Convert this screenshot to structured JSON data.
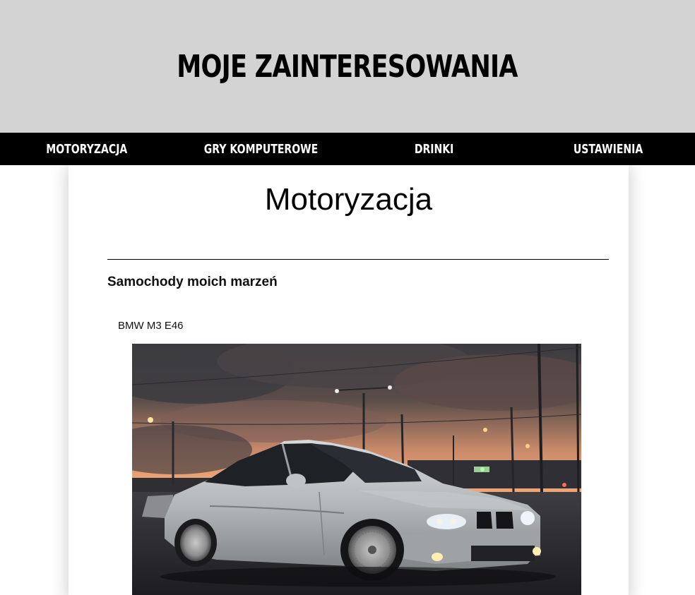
{
  "header": {
    "title": "MOJE ZAINTERESOWANIA"
  },
  "nav": {
    "items": [
      {
        "label": "MOTORYZACJA"
      },
      {
        "label": "GRY KOMPUTEROWE"
      },
      {
        "label": "DRINKI"
      },
      {
        "label": "USTAWIENIA"
      }
    ]
  },
  "main": {
    "heading": "Motoryzacja",
    "section_title": "Samochody moich marzeń",
    "car": {
      "name": "BMW M3 E46",
      "image_subject": "silver BMW M3 E46 at sunset"
    }
  },
  "colors": {
    "header_bg": "#d3d3d3",
    "nav_bg": "#000000",
    "nav_text": "#ffffff",
    "page_bg": "#ffffff"
  }
}
